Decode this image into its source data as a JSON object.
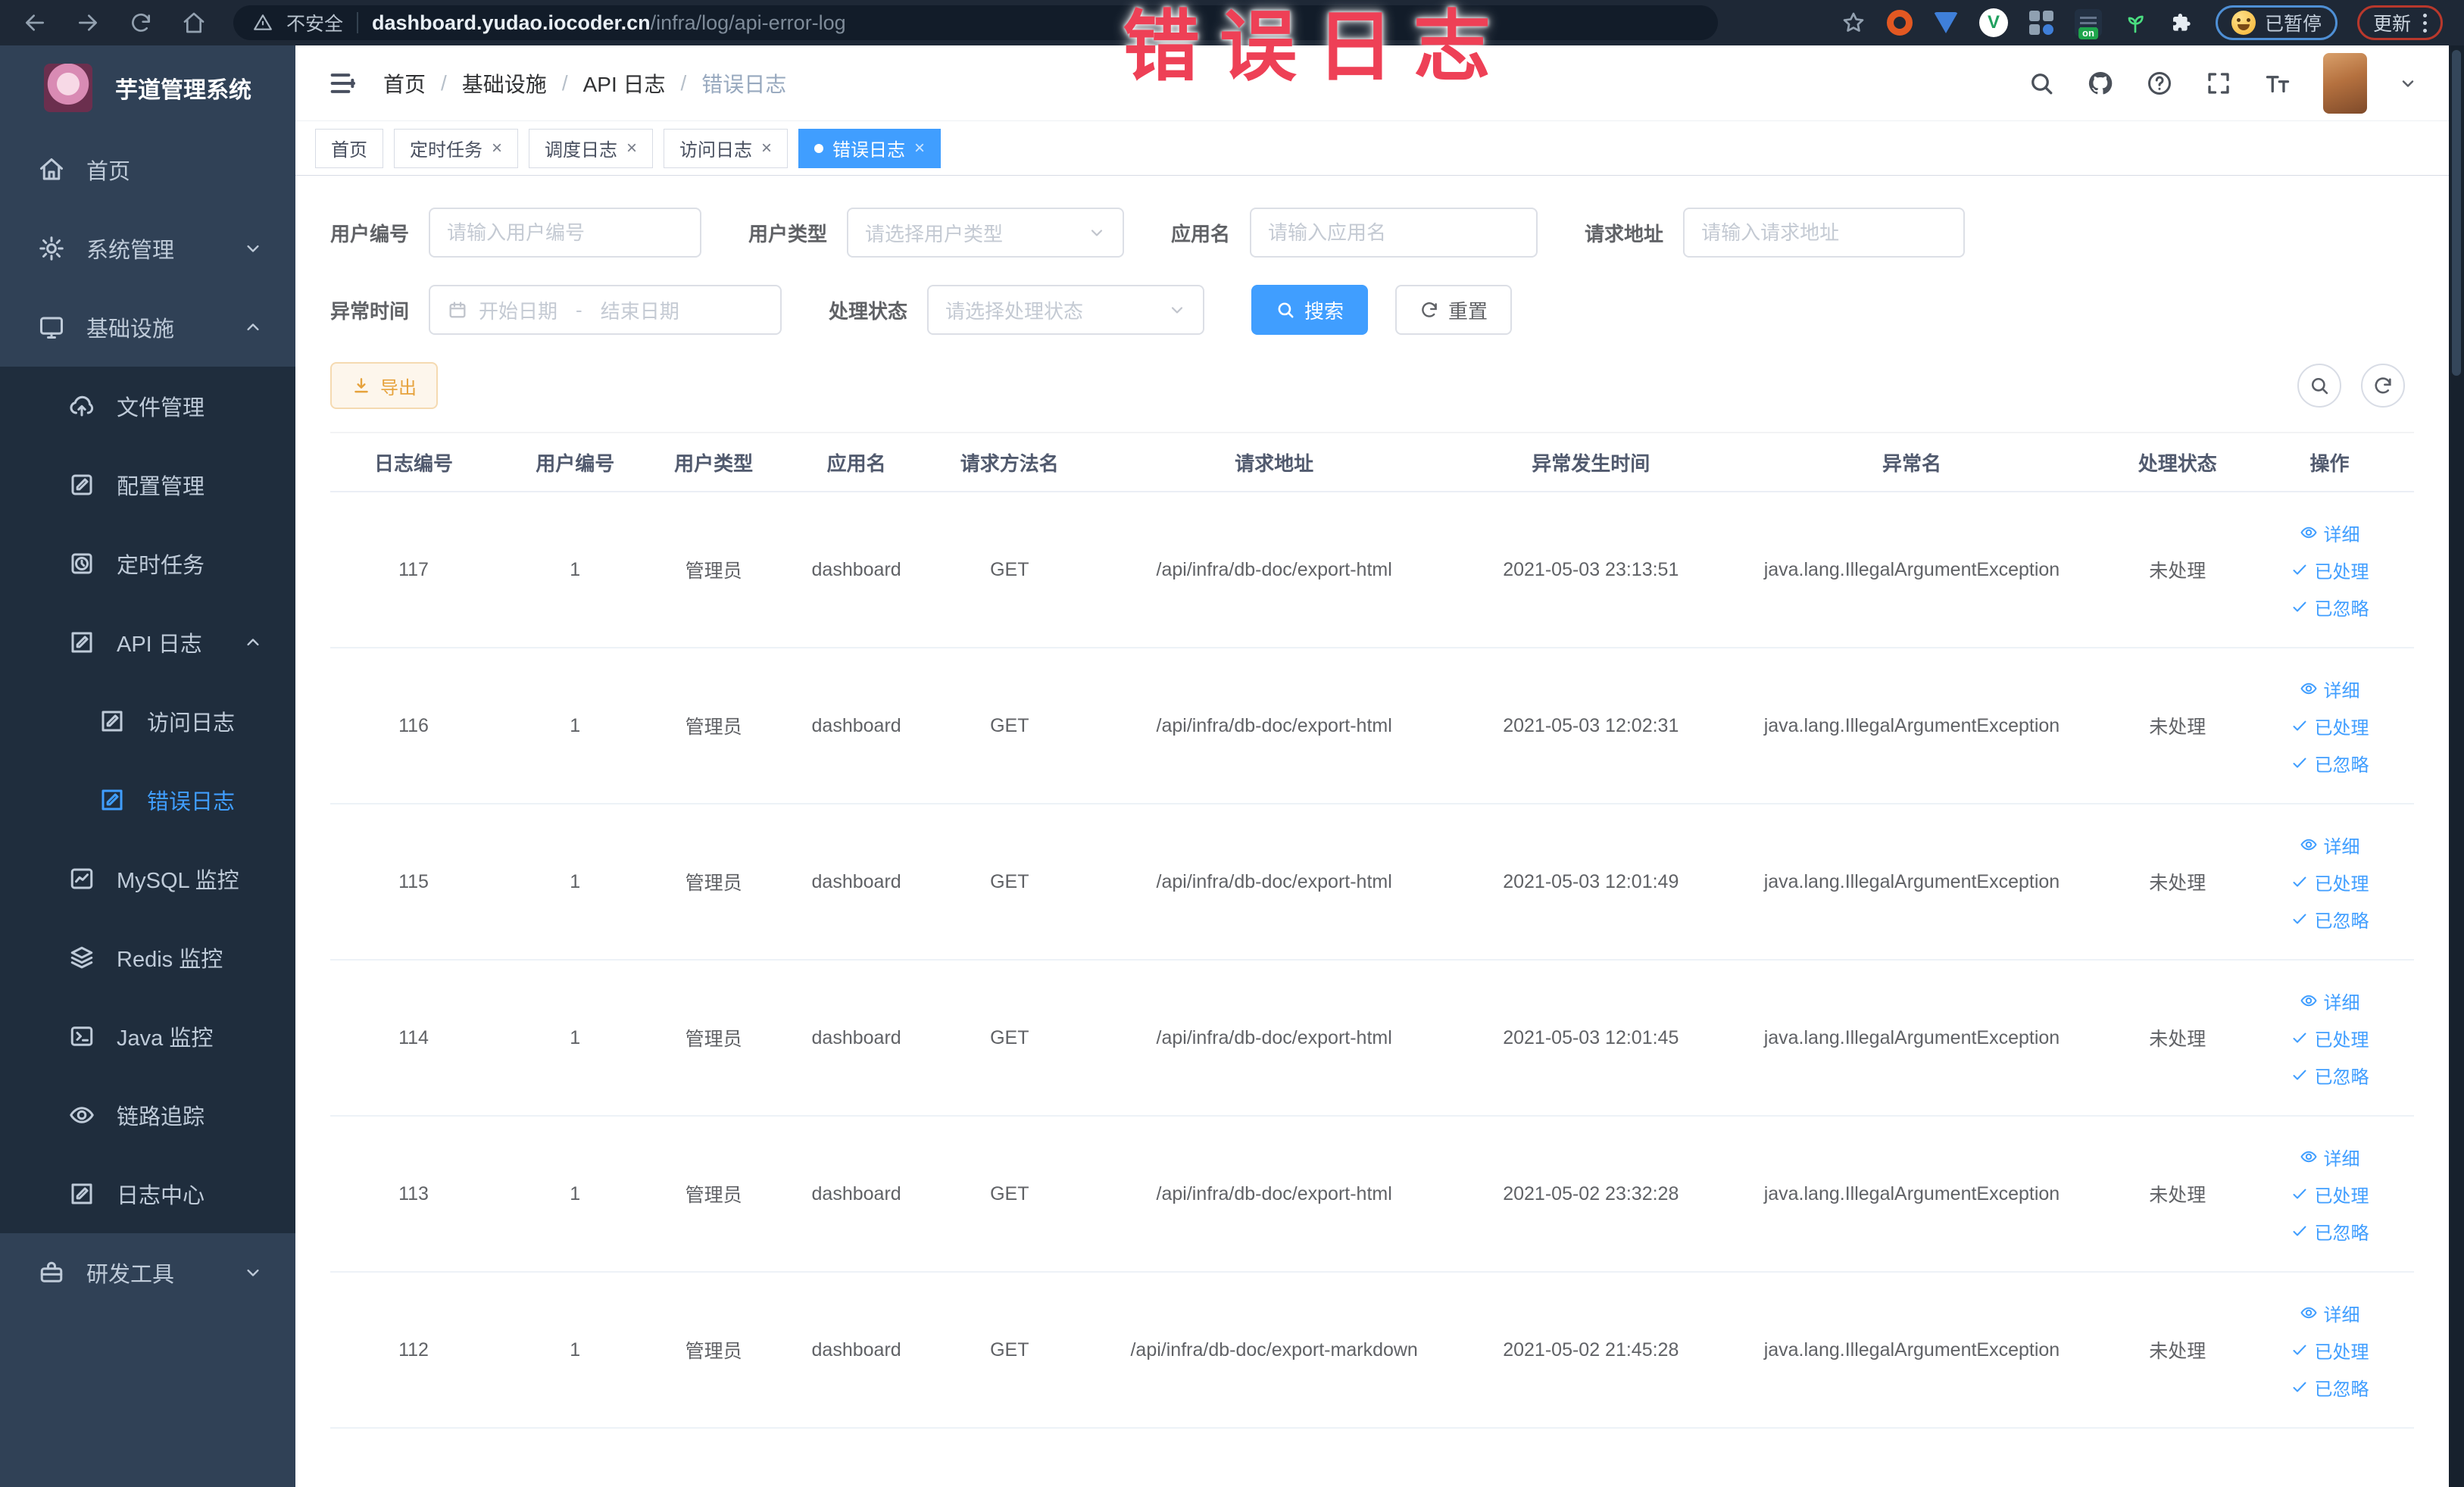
{
  "browser": {
    "security_label": "不安全",
    "url_host": "dashboard.yudao.iocoder.cn",
    "url_path": "/infra/log/api-error-log",
    "paused_chip": "已暂停",
    "update_label": "更新"
  },
  "annotation": {
    "text": "错误日志",
    "color": "#ee4056"
  },
  "sidebar": {
    "title": "芋道管理系统",
    "items": [
      {
        "id": "home",
        "label": "首页",
        "icon": "home",
        "level": 1
      },
      {
        "id": "system",
        "label": "系统管理",
        "icon": "gear",
        "level": 1,
        "chevron": "down"
      },
      {
        "id": "infra",
        "label": "基础设施",
        "icon": "monitor",
        "level": 1,
        "chevron": "up"
      },
      {
        "id": "file",
        "label": "文件管理",
        "icon": "cloud-upload",
        "level": 2
      },
      {
        "id": "config",
        "label": "配置管理",
        "icon": "edit",
        "level": 2
      },
      {
        "id": "job",
        "label": "定时任务",
        "icon": "clock",
        "level": 2
      },
      {
        "id": "api-log",
        "label": "API 日志",
        "icon": "edit-square",
        "level": 2,
        "chevron": "up"
      },
      {
        "id": "access-log",
        "label": "访问日志",
        "icon": "edit-square",
        "level": 3
      },
      {
        "id": "error-log",
        "label": "错误日志",
        "icon": "edit-square",
        "level": 3,
        "active": true
      },
      {
        "id": "mysql",
        "label": "MySQL 监控",
        "icon": "chart",
        "level": 2
      },
      {
        "id": "redis",
        "label": "Redis 监控",
        "icon": "layers",
        "level": 2
      },
      {
        "id": "java",
        "label": "Java 监控",
        "icon": "terminal",
        "level": 2
      },
      {
        "id": "trace",
        "label": "链路追踪",
        "icon": "eye",
        "level": 2
      },
      {
        "id": "log-center",
        "label": "日志中心",
        "icon": "edit-square",
        "level": 2
      },
      {
        "id": "dev-tools",
        "label": "研发工具",
        "icon": "toolbox",
        "level": 1,
        "chevron": "down"
      }
    ]
  },
  "navbar": {
    "breadcrumb": [
      "首页",
      "基础设施",
      "API 日志",
      "错误日志"
    ]
  },
  "tabs": [
    {
      "label": "首页",
      "closable": false,
      "active": false
    },
    {
      "label": "定时任务",
      "closable": true,
      "active": false
    },
    {
      "label": "调度日志",
      "closable": true,
      "active": false
    },
    {
      "label": "访问日志",
      "closable": true,
      "active": false
    },
    {
      "label": "错误日志",
      "closable": true,
      "active": true
    }
  ],
  "filters": {
    "user_id": {
      "label": "用户编号",
      "placeholder": "请输入用户编号"
    },
    "user_type": {
      "label": "用户类型",
      "placeholder": "请选择用户类型"
    },
    "app_name": {
      "label": "应用名",
      "placeholder": "请输入应用名"
    },
    "request_url": {
      "label": "请求地址",
      "placeholder": "请输入请求地址"
    },
    "exception_time": {
      "label": "异常时间",
      "start_placeholder": "开始日期",
      "separator": "-",
      "end_placeholder": "结束日期"
    },
    "process_status": {
      "label": "处理状态",
      "placeholder": "请选择处理状态"
    },
    "search_label": "搜索",
    "reset_label": "重置"
  },
  "toolbar": {
    "export_label": "导出"
  },
  "table": {
    "columns": [
      {
        "key": "id",
        "label": "日志编号",
        "width": "8%"
      },
      {
        "key": "user_id",
        "label": "用户编号",
        "width": "7.5%"
      },
      {
        "key": "user_type",
        "label": "用户类型",
        "width": "5.8%"
      },
      {
        "key": "app",
        "label": "应用名",
        "width": "7.9%"
      },
      {
        "key": "method",
        "label": "请求方法名",
        "width": "6.8%"
      },
      {
        "key": "url",
        "label": "请求地址",
        "width": "18.6%"
      },
      {
        "key": "time",
        "label": "异常发生时间",
        "width": "11.8%"
      },
      {
        "key": "exception",
        "label": "异常名",
        "width": "19%"
      },
      {
        "key": "status",
        "label": "处理状态",
        "width": "6.5%"
      },
      {
        "key": "actions",
        "label": "操作",
        "width": "8.1%"
      }
    ],
    "rows": [
      {
        "id": "117",
        "user_id": "1",
        "user_type": "管理员",
        "app": "dashboard",
        "method": "GET",
        "url": "/api/infra/db-doc/export-html",
        "time": "2021-05-03 23:13:51",
        "exception": "java.lang.IllegalArgumentException",
        "status": "未处理"
      },
      {
        "id": "116",
        "user_id": "1",
        "user_type": "管理员",
        "app": "dashboard",
        "method": "GET",
        "url": "/api/infra/db-doc/export-html",
        "time": "2021-05-03 12:02:31",
        "exception": "java.lang.IllegalArgumentException",
        "status": "未处理"
      },
      {
        "id": "115",
        "user_id": "1",
        "user_type": "管理员",
        "app": "dashboard",
        "method": "GET",
        "url": "/api/infra/db-doc/export-html",
        "time": "2021-05-03 12:01:49",
        "exception": "java.lang.IllegalArgumentException",
        "status": "未处理"
      },
      {
        "id": "114",
        "user_id": "1",
        "user_type": "管理员",
        "app": "dashboard",
        "method": "GET",
        "url": "/api/infra/db-doc/export-html",
        "time": "2021-05-03 12:01:45",
        "exception": "java.lang.IllegalArgumentException",
        "status": "未处理"
      },
      {
        "id": "113",
        "user_id": "1",
        "user_type": "管理员",
        "app": "dashboard",
        "method": "GET",
        "url": "/api/infra/db-doc/export-html",
        "time": "2021-05-02 23:32:28",
        "exception": "java.lang.IllegalArgumentException",
        "status": "未处理"
      },
      {
        "id": "112",
        "user_id": "1",
        "user_type": "管理员",
        "app": "dashboard",
        "method": "GET",
        "url": "/api/infra/db-doc/export-markdown",
        "time": "2021-05-02 21:45:28",
        "exception": "java.lang.IllegalArgumentException",
        "status": "未处理"
      }
    ],
    "row_actions": [
      {
        "id": "detail",
        "label": "详细",
        "icon": "eye-small"
      },
      {
        "id": "processed",
        "label": "已处理",
        "icon": "check"
      },
      {
        "id": "ignored",
        "label": "已忽略",
        "icon": "check"
      }
    ]
  },
  "colors": {
    "primary": "#409eff",
    "warning": "#e6a23c",
    "sidebar_bg": "#304156",
    "submenu_bg": "#1f2d3d",
    "browser_bar": "#1e2836",
    "annotation": "#ee4056"
  }
}
